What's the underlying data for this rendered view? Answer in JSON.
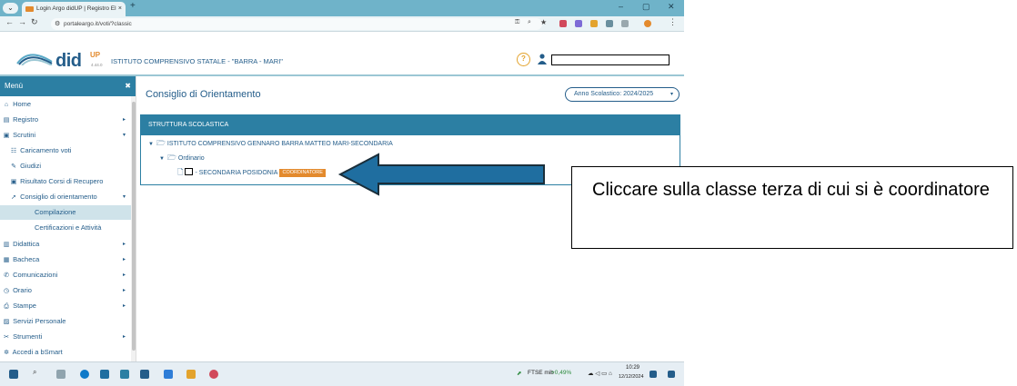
{
  "browser": {
    "tab_title": "Login Argo didUP | Registro El",
    "tab_close": "×",
    "new_tab": "+",
    "url": "portaleargo.it/voti/?classic",
    "win_min": "–",
    "win_max": "▢",
    "win_close": "✕"
  },
  "app": {
    "brand": "did",
    "brand_sup": "UP",
    "version": "4.44.0",
    "school": "ISTITUTO COMPRENSIVO STATALE - \"BARRA - MARI\"",
    "help": "?"
  },
  "sidebar": {
    "title": "Menù",
    "close": "✖",
    "items": [
      {
        "label": "Home",
        "icon": "⌂",
        "arrow": ""
      },
      {
        "label": "Registro",
        "icon": "▤",
        "arrow": "▸"
      },
      {
        "label": "Scrutini",
        "icon": "▣",
        "arrow": "▾"
      },
      {
        "label": "Caricamento voti",
        "icon": "☷",
        "arrow": ""
      },
      {
        "label": "Giudizi",
        "icon": "✎",
        "arrow": ""
      },
      {
        "label": "Risultato Corsi di Recupero",
        "icon": "▣",
        "arrow": ""
      },
      {
        "label": "Consiglio di orientamento",
        "icon": "➚",
        "arrow": "▾"
      },
      {
        "label": "Compilazione",
        "icon": "",
        "arrow": ""
      },
      {
        "label": "Certificazioni e Attività",
        "icon": "",
        "arrow": ""
      },
      {
        "label": "Didattica",
        "icon": "▥",
        "arrow": "▸"
      },
      {
        "label": "Bacheca",
        "icon": "▦",
        "arrow": "▸"
      },
      {
        "label": "Comunicazioni",
        "icon": "✆",
        "arrow": "▸"
      },
      {
        "label": "Orario",
        "icon": "◷",
        "arrow": "▸"
      },
      {
        "label": "Stampe",
        "icon": "⎙",
        "arrow": "▸"
      },
      {
        "label": "Servizi Personale",
        "icon": "▨",
        "arrow": ""
      },
      {
        "label": "Strumenti",
        "icon": "✂",
        "arrow": "▸"
      },
      {
        "label": "Accedi a bSmart",
        "icon": "✲",
        "arrow": ""
      }
    ]
  },
  "main": {
    "title": "Consiglio di Orientamento",
    "school_year": "Anno Scolastico: 2024/2025",
    "school_year_caret": "▾",
    "panel_title": "STRUTTURA SCOLASTICA",
    "tree": {
      "root": "ISTITUTO COMPRENSIVO GENNARO BARRA MATTEO MARI-SECONDARIA",
      "group": "Ordinario",
      "class_label": "- SECONDARIA POSIDONIA",
      "badge": "COORDINATORE"
    }
  },
  "taskbar": {
    "ticker": "FTSE mib",
    "ticker_change": "+0,49%",
    "time": "10:29",
    "date": "12/12/2024"
  },
  "callout": {
    "text": "Cliccare sulla classe terza di cui si è coordinatore"
  },
  "colors": {
    "accent": "#2c7fa3",
    "text_blue": "#245d8a",
    "badge": "#e38a2d",
    "arrow": "#1f6ea0"
  }
}
